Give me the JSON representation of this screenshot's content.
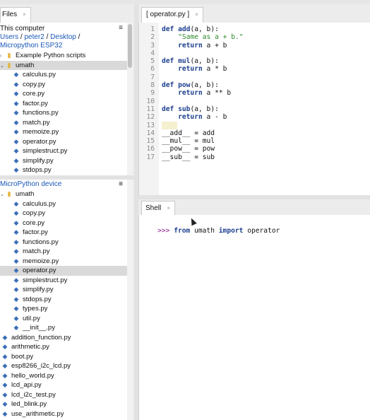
{
  "files_tab": {
    "label": "Files",
    "close": "×"
  },
  "computer": {
    "title": "This computer",
    "path_users": "Users",
    "path_sep": "/",
    "path_peter": "peter2",
    "path_desktop": "Desktop",
    "path_esp": "Micropython ESP32",
    "menu": "≡",
    "items": [
      {
        "label": "Example Python scripts",
        "type": "folder",
        "arrow": "›"
      },
      {
        "label": "umath",
        "type": "folder",
        "arrow": "⌄"
      },
      {
        "label": "calculus.py",
        "type": "py"
      },
      {
        "label": "copy.py",
        "type": "py"
      },
      {
        "label": "core.py",
        "type": "py"
      },
      {
        "label": "factor.py",
        "type": "py"
      },
      {
        "label": "functions.py",
        "type": "py"
      },
      {
        "label": "match.py",
        "type": "py"
      },
      {
        "label": "memoize.py",
        "type": "py"
      },
      {
        "label": "operator.py",
        "type": "py"
      },
      {
        "label": "simplestruct.py",
        "type": "py"
      },
      {
        "label": "simplify.py",
        "type": "py"
      },
      {
        "label": "stdops.py",
        "type": "py"
      }
    ]
  },
  "device": {
    "title": "MicroPython device",
    "menu": "≡",
    "items": [
      {
        "label": "umath",
        "type": "folder",
        "arrow": "⌄"
      },
      {
        "label": "calculus.py",
        "type": "py"
      },
      {
        "label": "copy.py",
        "type": "py"
      },
      {
        "label": "core.py",
        "type": "py"
      },
      {
        "label": "factor.py",
        "type": "py"
      },
      {
        "label": "functions.py",
        "type": "py"
      },
      {
        "label": "match.py",
        "type": "py"
      },
      {
        "label": "memoize.py",
        "type": "py"
      },
      {
        "label": "operator.py",
        "type": "py"
      },
      {
        "label": "simplestruct.py",
        "type": "py"
      },
      {
        "label": "simplify.py",
        "type": "py"
      },
      {
        "label": "stdops.py",
        "type": "py"
      },
      {
        "label": "types.py",
        "type": "py"
      },
      {
        "label": "util.py",
        "type": "py"
      },
      {
        "label": "__init__.py",
        "type": "py"
      },
      {
        "label": "addition_function.py",
        "type": "py"
      },
      {
        "label": "arithmetic.py",
        "type": "py"
      },
      {
        "label": "boot.py",
        "type": "py"
      },
      {
        "label": "esp8266_i2c_lcd.py",
        "type": "py"
      },
      {
        "label": "hello_world.py",
        "type": "py"
      },
      {
        "label": "lcd_api.py",
        "type": "py"
      },
      {
        "label": "lcd_i2c_test.py",
        "type": "py"
      },
      {
        "label": "led_blink.py",
        "type": "py"
      },
      {
        "label": "use_arithmetic.py",
        "type": "py"
      }
    ]
  },
  "editor": {
    "tab_label": "[ operator.py ]",
    "tab_close": "×",
    "lines": [
      {
        "n": "1",
        "code": "def add(a, b):"
      },
      {
        "n": "2",
        "code": "    \"Same as a + b.\""
      },
      {
        "n": "3",
        "code": "    return a + b"
      },
      {
        "n": "4",
        "code": ""
      },
      {
        "n": "5",
        "code": "def mul(a, b):"
      },
      {
        "n": "6",
        "code": "    return a * b"
      },
      {
        "n": "7",
        "code": ""
      },
      {
        "n": "8",
        "code": "def pow(a, b):"
      },
      {
        "n": "9",
        "code": "    return a ** b"
      },
      {
        "n": "10",
        "code": ""
      },
      {
        "n": "11",
        "code": "def sub(a, b):"
      },
      {
        "n": "12",
        "code": "    return a - b"
      },
      {
        "n": "13",
        "code": ""
      },
      {
        "n": "14",
        "code": "__add__ = add"
      },
      {
        "n": "15",
        "code": "__mul__ = mul"
      },
      {
        "n": "16",
        "code": "__pow__ = pow"
      },
      {
        "n": "17",
        "code": "__sub__ = sub"
      }
    ]
  },
  "shell": {
    "tab_label": "Shell",
    "tab_close": "×",
    "prompt": ">>>",
    "command": "from umath import operator"
  },
  "colors": {
    "accent": "#1a57b8",
    "selection": "#d9d9d9",
    "keyword": "#1d3f8f",
    "string": "#2d8a2d",
    "prompt": "#8a1d8a"
  }
}
